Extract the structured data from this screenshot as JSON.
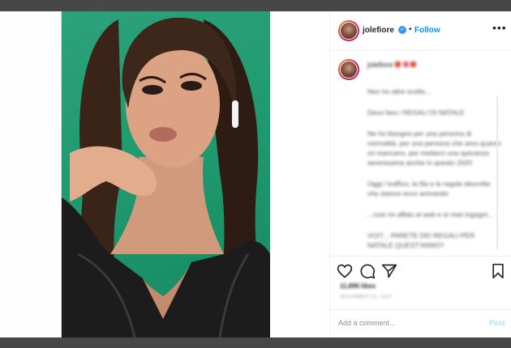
{
  "colors": {
    "window_bar": "#474747",
    "accent": "#0095f6",
    "backdrop_green": "#1f9a6f",
    "verified": "#3897f0"
  },
  "header": {
    "username": "jolefiore",
    "separator": "•",
    "follow_label": "Follow",
    "more_label": "•••",
    "verified_icon": "verified-badge"
  },
  "caption": {
    "user": "jolefiore",
    "lines": [
      "Non ho altre scelte...",
      "Devo fare i REGALI DI NATALE",
      "Ne ho bisogno per una persona di normalità, per una persona che amo quanto mi mancano, per metterci una speranza serenissima anche in questo 2020",
      "Oggi / traffico, la fila e le regole descritte che stanno ecco arrivando",
      "...così mi affido al web e ai miei ingegni...",
      "VOI?... PARETE DEI REGALI PER NATALE QUEST'ANNO?"
    ]
  },
  "actions": {
    "like_icon": "heart-icon",
    "comment_icon": "comment-icon",
    "share_icon": "paper-plane-icon",
    "save_icon": "bookmark-icon"
  },
  "likes_text": "11,896 likes",
  "date_text": "DECEMBER 15, 2020",
  "comment_box": {
    "placeholder": "Add a comment...",
    "post_label": "Post"
  }
}
